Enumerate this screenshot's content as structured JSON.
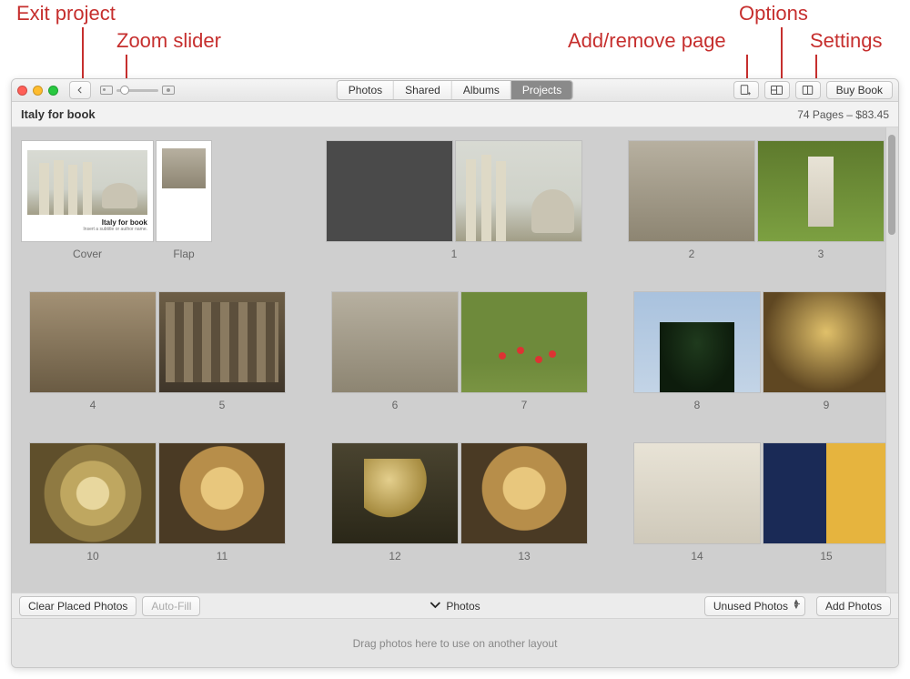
{
  "annotations": {
    "exit": "Exit project",
    "zoom": "Zoom slider",
    "addremove": "Add/remove page",
    "options": "Options",
    "settings": "Settings"
  },
  "toolbar": {
    "back_icon": "chevron-left",
    "segments": {
      "photos": "Photos",
      "shared": "Shared",
      "albums": "Albums",
      "projects": "Projects"
    },
    "active_segment": "projects",
    "addpage_icon": "page-plus",
    "options_icon": "layout-options",
    "settings_icon": "book-settings",
    "buy_label": "Buy Book"
  },
  "subheader": {
    "title": "Italy for book",
    "summary": "74 Pages – $83.45"
  },
  "pages": {
    "cover_label": "Cover",
    "flap_label": "Flap",
    "cover_title": "Italy for book",
    "cover_subtitle": "Insert a subtitle or author name.",
    "labels": [
      "1",
      "2",
      "3",
      "4",
      "5",
      "6",
      "7",
      "8",
      "9",
      "10",
      "11",
      "12",
      "13",
      "14",
      "15"
    ]
  },
  "footer": {
    "clear": "Clear Placed Photos",
    "autofill": "Auto-Fill",
    "photos_toggle": "Photos",
    "filter": "Unused Photos",
    "add": "Add Photos",
    "tray_hint": "Drag photos here to use on another layout"
  }
}
